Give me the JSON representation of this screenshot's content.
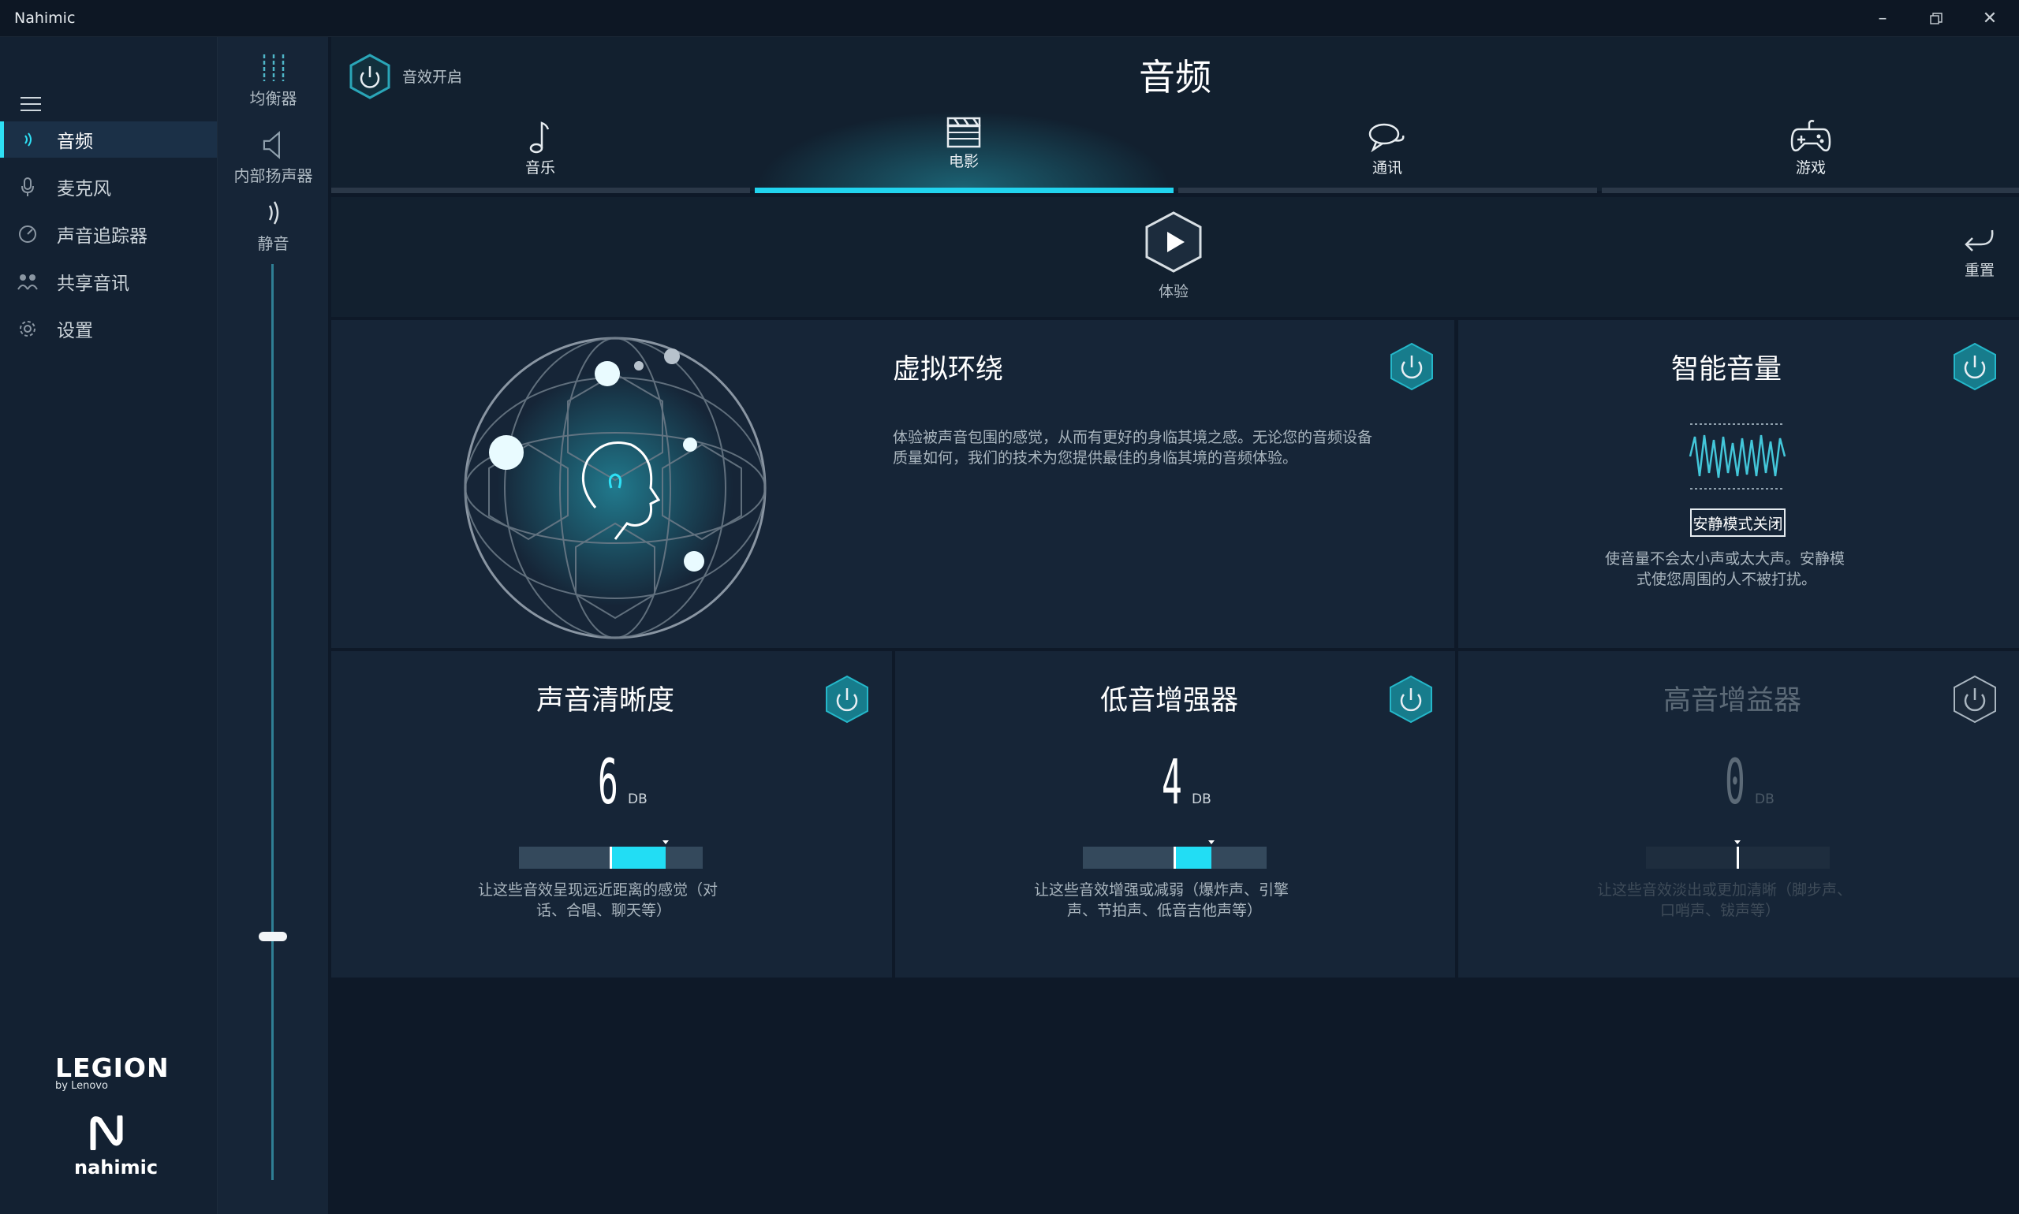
{
  "window": {
    "title": "Nahimic"
  },
  "sidebar": {
    "items": [
      {
        "label": "音频",
        "icon": "speaker-wave-icon",
        "active": true
      },
      {
        "label": "麦克风",
        "icon": "microphone-icon",
        "active": false
      },
      {
        "label": "声音追踪器",
        "icon": "radar-icon",
        "active": false
      },
      {
        "label": "共享音讯",
        "icon": "share-people-icon",
        "active": false
      },
      {
        "label": "设置",
        "icon": "gear-icon",
        "active": false
      }
    ],
    "brand": {
      "legion": "LEGION",
      "lenovo": "by Lenovo",
      "nahimic": "nahimic"
    }
  },
  "rail": {
    "items": [
      {
        "label": "均衡器",
        "icon": "equalizer-icon"
      },
      {
        "label": "内部扬声器",
        "icon": "speaker-icon"
      },
      {
        "label": "静音",
        "icon": "mute-wave-icon"
      }
    ],
    "volume_level": 0.12
  },
  "header": {
    "effect_label": "音效开启",
    "title": "音频"
  },
  "tabs": [
    {
      "label": "音乐",
      "icon": "music-note-icon",
      "active": false
    },
    {
      "label": "电影",
      "icon": "clapperboard-icon",
      "active": true
    },
    {
      "label": "通讯",
      "icon": "chat-bubbles-icon",
      "active": false
    },
    {
      "label": "游戏",
      "icon": "gamepad-icon",
      "active": false
    }
  ],
  "experience": {
    "label": "体验",
    "reset_label": "重置"
  },
  "cards": {
    "surround": {
      "title": "虚拟环绕",
      "desc_line1": "体验被声音包围的感觉，从而有更好的身临其境之感。无论您的音频设备",
      "desc_line2": "质量如何，我们的技术为您提供最佳的身临其境的音频体验。"
    },
    "smart_volume": {
      "title": "智能音量",
      "quiet_mode_label": "安静模式关闭",
      "desc_line1": "使音量不会太小声或太大声。安静模",
      "desc_line2": "式使您周围的人不被打扰。"
    },
    "clarity": {
      "title": "声音清晰度",
      "value": "6",
      "unit": "DB",
      "level": 0.6,
      "desc_line1": "让这些音效呈现远近距离的感觉（对",
      "desc_line2": "话、合唱、聊天等）"
    },
    "bass": {
      "title": "低音增强器",
      "value": "4",
      "unit": "DB",
      "level": 0.4,
      "desc_line1": "让这些音效增强或减弱（爆炸声、引擎",
      "desc_line2": "声、节拍声、低音吉他声等）"
    },
    "treble": {
      "title": "高音增益器",
      "value": "0",
      "unit": "DB",
      "level": 0.0,
      "desc_line1": "让这些音效淡出或更加清晰（脚步声、",
      "desc_line2": "口哨声、钹声等）"
    }
  },
  "colors": {
    "accent": "#21d4ef",
    "background": "#0e1928",
    "card": "#162537",
    "sidebar": "#132132"
  }
}
